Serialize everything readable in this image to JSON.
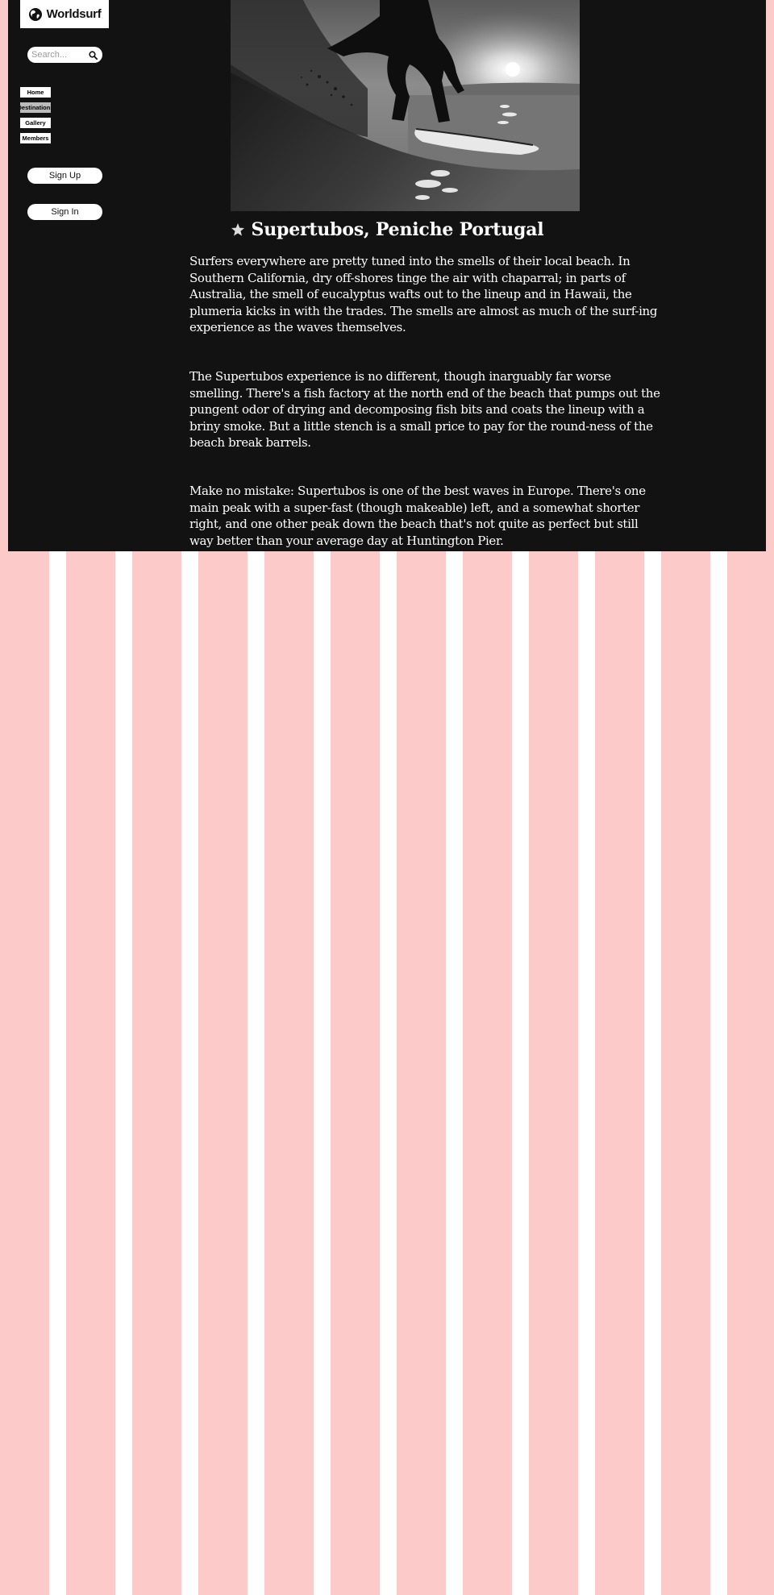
{
  "brand": {
    "name": "Worldsurf",
    "logo_icon": "globe-icon"
  },
  "search": {
    "placeholder": "Search...",
    "icon": "search-icon"
  },
  "nav": {
    "items": [
      {
        "label": "Home",
        "active": false
      },
      {
        "label": "Destinations",
        "active": true
      },
      {
        "label": "Gallery",
        "active": false
      },
      {
        "label": "Members",
        "active": false
      }
    ]
  },
  "auth": {
    "sign_up_label": "Sign Up",
    "sign_in_label": "Sign In"
  },
  "hero": {
    "icon": "surfer-photo"
  },
  "article": {
    "title": "Supertubos, Peniche Portugal",
    "title_icon": "star-icon",
    "paragraphs": [
      "Surfers everywhere are pretty tuned into the smells of their local beach. In Southern California, dry off-shores tinge the air with chaparral; in parts of Australia, the smell of eucalyptus wafts out to the lineup and in Hawaii, the plumeria kicks in with the trades. The smells are almost as much of the surf-ing experience as the waves themselves.",
      "The Supertubos experience is no different, though inarguably far worse smelling. There's a fish factory at the north end of the beach that pumps out the pungent odor of drying and decomposing fish bits and coats the lineup with a briny smoke. But a little stench is a small price to pay for the round-ness of the beach break barrels.",
      "Make no mistake: Supertubos is one of the best waves in Europe. There's one main peak with a super-fast (though makeable) left, and a somewhat shorter right, and one other peak down the beach that's not quite as perfect but still way better than your average day at Huntington Pier."
    ]
  },
  "colors": {
    "panel": "#121212",
    "stripe_pink": "#fdcaca",
    "stripe_white": "#ffffff",
    "text": "#ffffff"
  }
}
